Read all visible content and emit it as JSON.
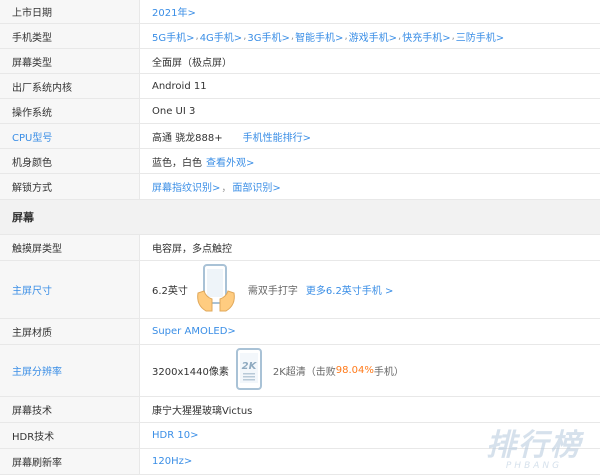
{
  "rows_top": [
    {
      "label": "上市日期",
      "items": [
        {
          "text": "2021年>",
          "link": true
        }
      ]
    },
    {
      "label": "手机类型",
      "items": [
        {
          "text": "5G手机>",
          "link": true
        },
        {
          "text": "4G手机>",
          "link": true
        },
        {
          "text": "3G手机>",
          "link": true
        },
        {
          "text": "智能手机>",
          "link": true
        },
        {
          "text": "游戏手机>",
          "link": true
        },
        {
          "text": "快充手机>",
          "link": true
        },
        {
          "text": "三防手机>",
          "link": true
        }
      ]
    },
    {
      "label": "屏幕类型",
      "items": [
        {
          "text": "全面屏（极点屏）",
          "link": false
        }
      ]
    },
    {
      "label": "出厂系统内核",
      "items": [
        {
          "text": "Android 11",
          "link": false
        }
      ]
    },
    {
      "label": "操作系统",
      "items": [
        {
          "text": "One UI 3",
          "link": false
        }
      ]
    },
    {
      "label": "CPU型号",
      "items": [
        {
          "text": "高通 骁龙888+",
          "link": false
        },
        {
          "text": "手机性能排行>",
          "link": true
        }
      ]
    },
    {
      "label": "机身颜色",
      "items": [
        {
          "text": "蓝色，白色",
          "link": false
        },
        {
          "text": "查看外观>",
          "link": true
        }
      ]
    },
    {
      "label": "解锁方式",
      "items": [
        {
          "text": "屏幕指纹识别>",
          "link": true
        },
        {
          "text": "面部识别>",
          "link": true
        }
      ]
    }
  ],
  "section_title": "屏幕",
  "touch": {
    "label": "触摸屏类型",
    "value": "电容屏，多点触控"
  },
  "size": {
    "label": "主屏尺寸",
    "value": "6.2英寸",
    "note": "需双手打字",
    "more": "更多6.2英寸手机 >"
  },
  "material": {
    "label": "主屏材质",
    "value": "Super AMOLED>"
  },
  "resolution": {
    "label": "主屏分辨率",
    "value": "3200x1440像素",
    "icon_text": "2K",
    "note_prefix": "2K超清（击败",
    "percent": "98.04%",
    "note_suffix": "手机）"
  },
  "tech": {
    "label": "屏幕技术",
    "value": "康宁大猩猩玻璃Victus"
  },
  "hdr": {
    "label": "HDR技术",
    "value": "HDR 10>"
  },
  "refresh": {
    "label": "屏幕刷新率",
    "value": "120Hz>"
  },
  "watermark": {
    "main": "排行榜",
    "sub": "PHBANG"
  },
  "colors": {
    "link": "#3a8ee6",
    "accent": "#ff7a1a",
    "label_bg": "#f7f7f7"
  }
}
